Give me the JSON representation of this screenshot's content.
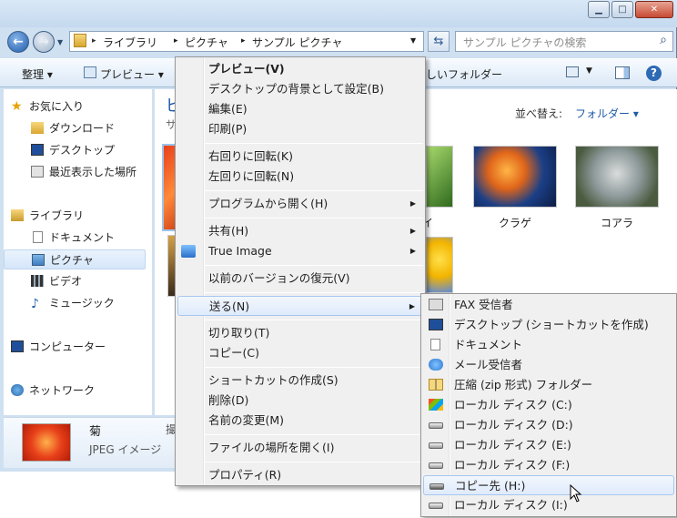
{
  "window": {
    "address_segments": [
      "ライブラリ",
      "ピクチャ",
      "サンプル ピクチャ"
    ],
    "search_placeholder": "サンプル ピクチャの検索"
  },
  "toolbar": {
    "organize": "整理",
    "preview": "プレビュー",
    "new_folder_partial": "しいフォルダー"
  },
  "sidebar": {
    "favorites": "お気に入り",
    "downloads": "ダウンロード",
    "desktop": "デスクトップ",
    "recent": "最近表示した場所",
    "libraries": "ライブラリ",
    "documents": "ドキュメント",
    "pictures": "ピクチャ",
    "videos": "ビデオ",
    "music": "ミュージック",
    "computer": "コンピューター",
    "network": "ネットワーク"
  },
  "content": {
    "title_partial": "ピ",
    "subtitle_partial": "サ",
    "sort_label": "並べ替え:",
    "sort_value": "フォルダー",
    "thumbs": [
      {
        "label": "イ",
        "color": "#3f7a2a"
      },
      {
        "label": "クラゲ",
        "color": "#1b3f86"
      },
      {
        "label": "コアラ",
        "color": "#7a8d90"
      }
    ]
  },
  "details": {
    "name": "菊",
    "type": "JPEG イメージ",
    "extra_partial": "撮"
  },
  "context_menu": {
    "items": [
      {
        "label": "プレビュー(V)"
      },
      {
        "label": "デスクトップの背景として設定(B)"
      },
      {
        "label": "編集(E)"
      },
      {
        "label": "印刷(P)"
      },
      {
        "label": "右回りに回転(K)"
      },
      {
        "label": "左回りに回転(N)"
      },
      {
        "label": "プログラムから開く(H)"
      },
      {
        "label": "共有(H)"
      },
      {
        "label": "True Image"
      },
      {
        "label": "以前のバージョンの復元(V)"
      },
      {
        "label": "送る(N)"
      },
      {
        "label": "切り取り(T)"
      },
      {
        "label": "コピー(C)"
      },
      {
        "label": "ショートカットの作成(S)"
      },
      {
        "label": "削除(D)"
      },
      {
        "label": "名前の変更(M)"
      },
      {
        "label": "ファイルの場所を開く(I)"
      },
      {
        "label": "プロパティ(R)"
      }
    ]
  },
  "send_to_menu": {
    "items": [
      {
        "label": "FAX 受信者"
      },
      {
        "label": "デスクトップ (ショートカットを作成)"
      },
      {
        "label": "ドキュメント"
      },
      {
        "label": "メール受信者"
      },
      {
        "label": "圧縮 (zip 形式) フォルダー"
      },
      {
        "label": "ローカル ディスク (C:)"
      },
      {
        "label": "ローカル ディスク (D:)"
      },
      {
        "label": "ローカル ディスク (E:)"
      },
      {
        "label": "ローカル ディスク (F:)"
      },
      {
        "label": "コピー先 (H:)"
      },
      {
        "label": "ローカル ディスク (I:)"
      }
    ]
  },
  "colors": {
    "accent": "#1e5aa8",
    "highlight_border": "#a8c7ef",
    "menu_bg": "#f0f0f0"
  }
}
